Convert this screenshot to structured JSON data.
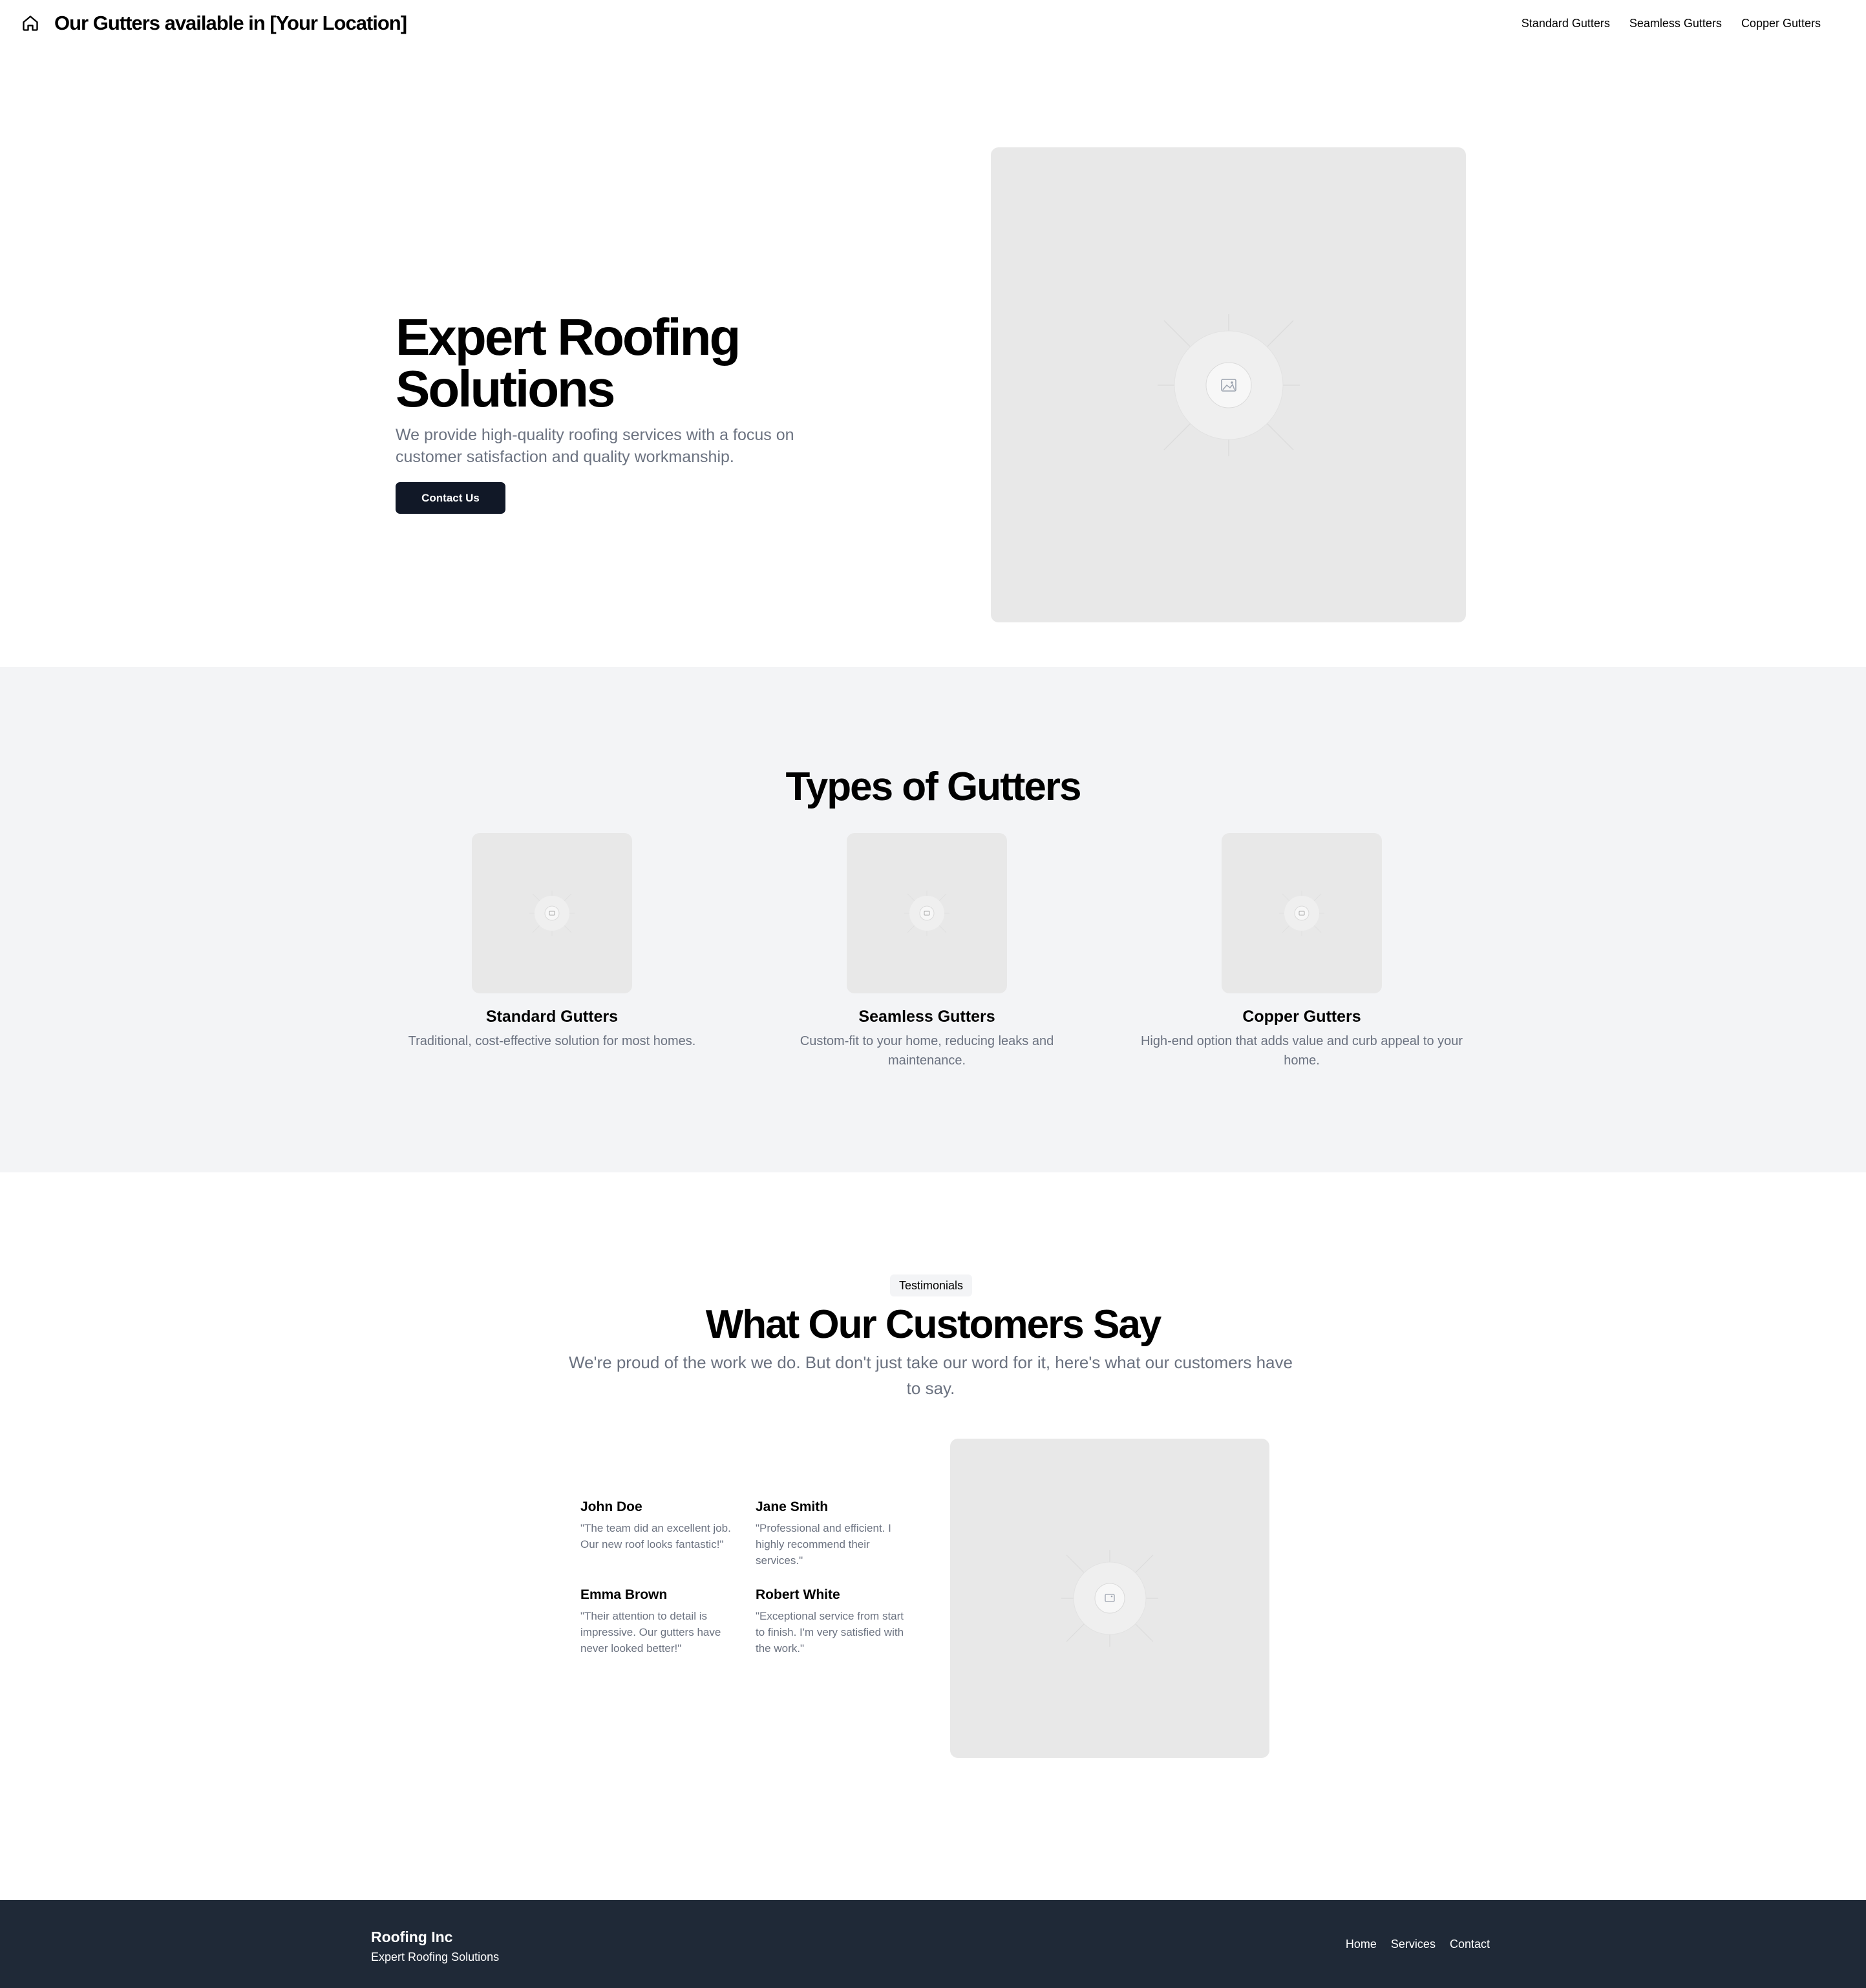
{
  "header": {
    "title": "Our Gutters available in [Your Location]",
    "home_icon": "home-icon",
    "nav": [
      "Standard Gutters",
      "Seamless Gutters",
      "Copper Gutters"
    ]
  },
  "hero": {
    "title": "Expert Roofing Solutions",
    "subtitle": "We provide high-quality roofing services with a focus on customer satisfaction and quality workmanship.",
    "cta": "Contact Us",
    "image_icon": "image-placeholder-icon"
  },
  "types": {
    "title": "Types of Gutters",
    "items": [
      {
        "title": "Standard Gutters",
        "desc": "Traditional, cost-effective solution for most homes."
      },
      {
        "title": "Seamless Gutters",
        "desc": "Custom-fit to your home, reducing leaks and maintenance."
      },
      {
        "title": "Copper Gutters",
        "desc": "High-end option that adds value and curb appeal to your home."
      }
    ]
  },
  "testimonials": {
    "badge": "Testimonials",
    "title": "What Our Customers Say",
    "subtitle": "We're proud of the work we do. But don't just take our word for it, here's what our customers have to say.",
    "items": [
      {
        "name": "John Doe",
        "quote": "\"The team did an excellent job. Our new roof looks fantastic!\""
      },
      {
        "name": "Jane Smith",
        "quote": "\"Professional and efficient. I highly recommend their services.\""
      },
      {
        "name": "Emma Brown",
        "quote": "\"Their attention to detail is impressive. Our gutters have never looked better!\""
      },
      {
        "name": "Robert White",
        "quote": "\"Exceptional service from start to finish. I'm very satisfied with the work.\""
      }
    ]
  },
  "footer": {
    "brand": "Roofing Inc",
    "tagline": "Expert Roofing Solutions",
    "nav": [
      "Home",
      "Services",
      "Contact"
    ]
  },
  "colors": {
    "primary_button": "#111827",
    "footer_bg": "#1f2937",
    "section_bg": "#f3f4f6",
    "muted_text": "#6b7280",
    "placeholder_bg": "#e8e8e8"
  }
}
